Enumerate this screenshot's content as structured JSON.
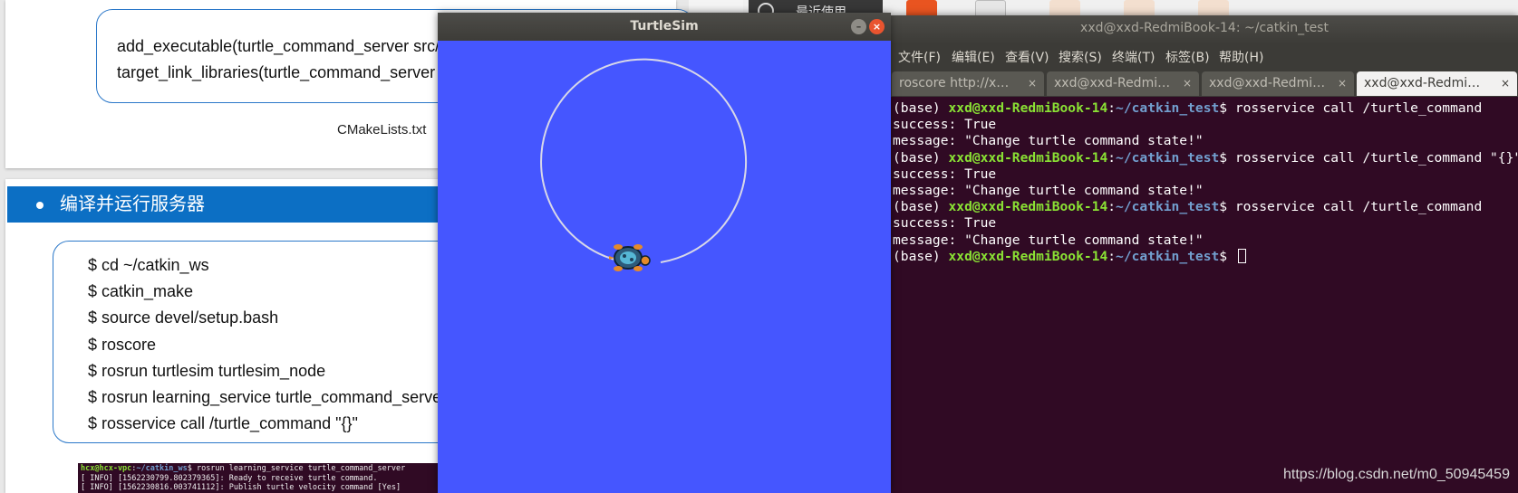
{
  "slide": {
    "top_code": [
      "add_executable(turtle_command_server src/turtle_command_server.cpp)",
      "target_link_libraries(turtle_command_server ${catkin_LIBRARIES})"
    ],
    "caption": "CMakeLists.txt",
    "section_title": "编译并运行服务器",
    "steps": [
      "$ cd ~/catkin_ws",
      "$ catkin_make",
      "$ source devel/setup.bash",
      "$ roscore",
      "$ rosrun turtlesim turtlesim_node",
      "$ rosrun learning_service turtle_command_server",
      "$ rosservice call /turtle_command \"{}\""
    ],
    "mini_terminal": {
      "prompt_user": "hcx@hcx-vpc",
      "prompt_path": "~/catkin_ws",
      "command": "$ rosrun learning_service turtle_command_server",
      "lines": [
        "[ INFO] [1562230799.802379365]: Ready to receive turtle command.",
        "[ INFO] [1562230816.003741112]: Publish turtle velocity command [Yes]"
      ]
    }
  },
  "file_manager": {
    "sidebar_label": "最近使用"
  },
  "turtlesim": {
    "title": "TurtleSim",
    "minimize_icon": "–",
    "close_icon": "×",
    "background_color": "#4556ff",
    "path_color": "#d8d8e8"
  },
  "terminal": {
    "title": "xxd@xxd-RedmiBook-14: ~/catkin_test",
    "menu": [
      "文件(F)",
      "编辑(E)",
      "查看(V)",
      "搜索(S)",
      "终端(T)",
      "标签(B)",
      "帮助(H)"
    ],
    "tabs": [
      {
        "label": "roscore http://x…",
        "close": "×"
      },
      {
        "label": "xxd@xxd-Redmi…",
        "close": "×"
      },
      {
        "label": "xxd@xxd-Redmi…",
        "close": "×"
      },
      {
        "label": "xxd@xxd-Redmi…",
        "close": "×"
      }
    ],
    "prompt": {
      "env": "(base) ",
      "user_host": "xxd@xxd-RedmiBook-14",
      "colon": ":",
      "path": "~/catkin_test",
      "dollar": "$ "
    },
    "commands": [
      "rosservice call /turtle_command",
      "rosservice call /turtle_command \"{}\"",
      "rosservice call /turtle_command"
    ],
    "success_line": "success: True",
    "message_line": "message: \"Change turtle command state!\""
  },
  "watermark": "https://blog.csdn.net/m0_50945459"
}
